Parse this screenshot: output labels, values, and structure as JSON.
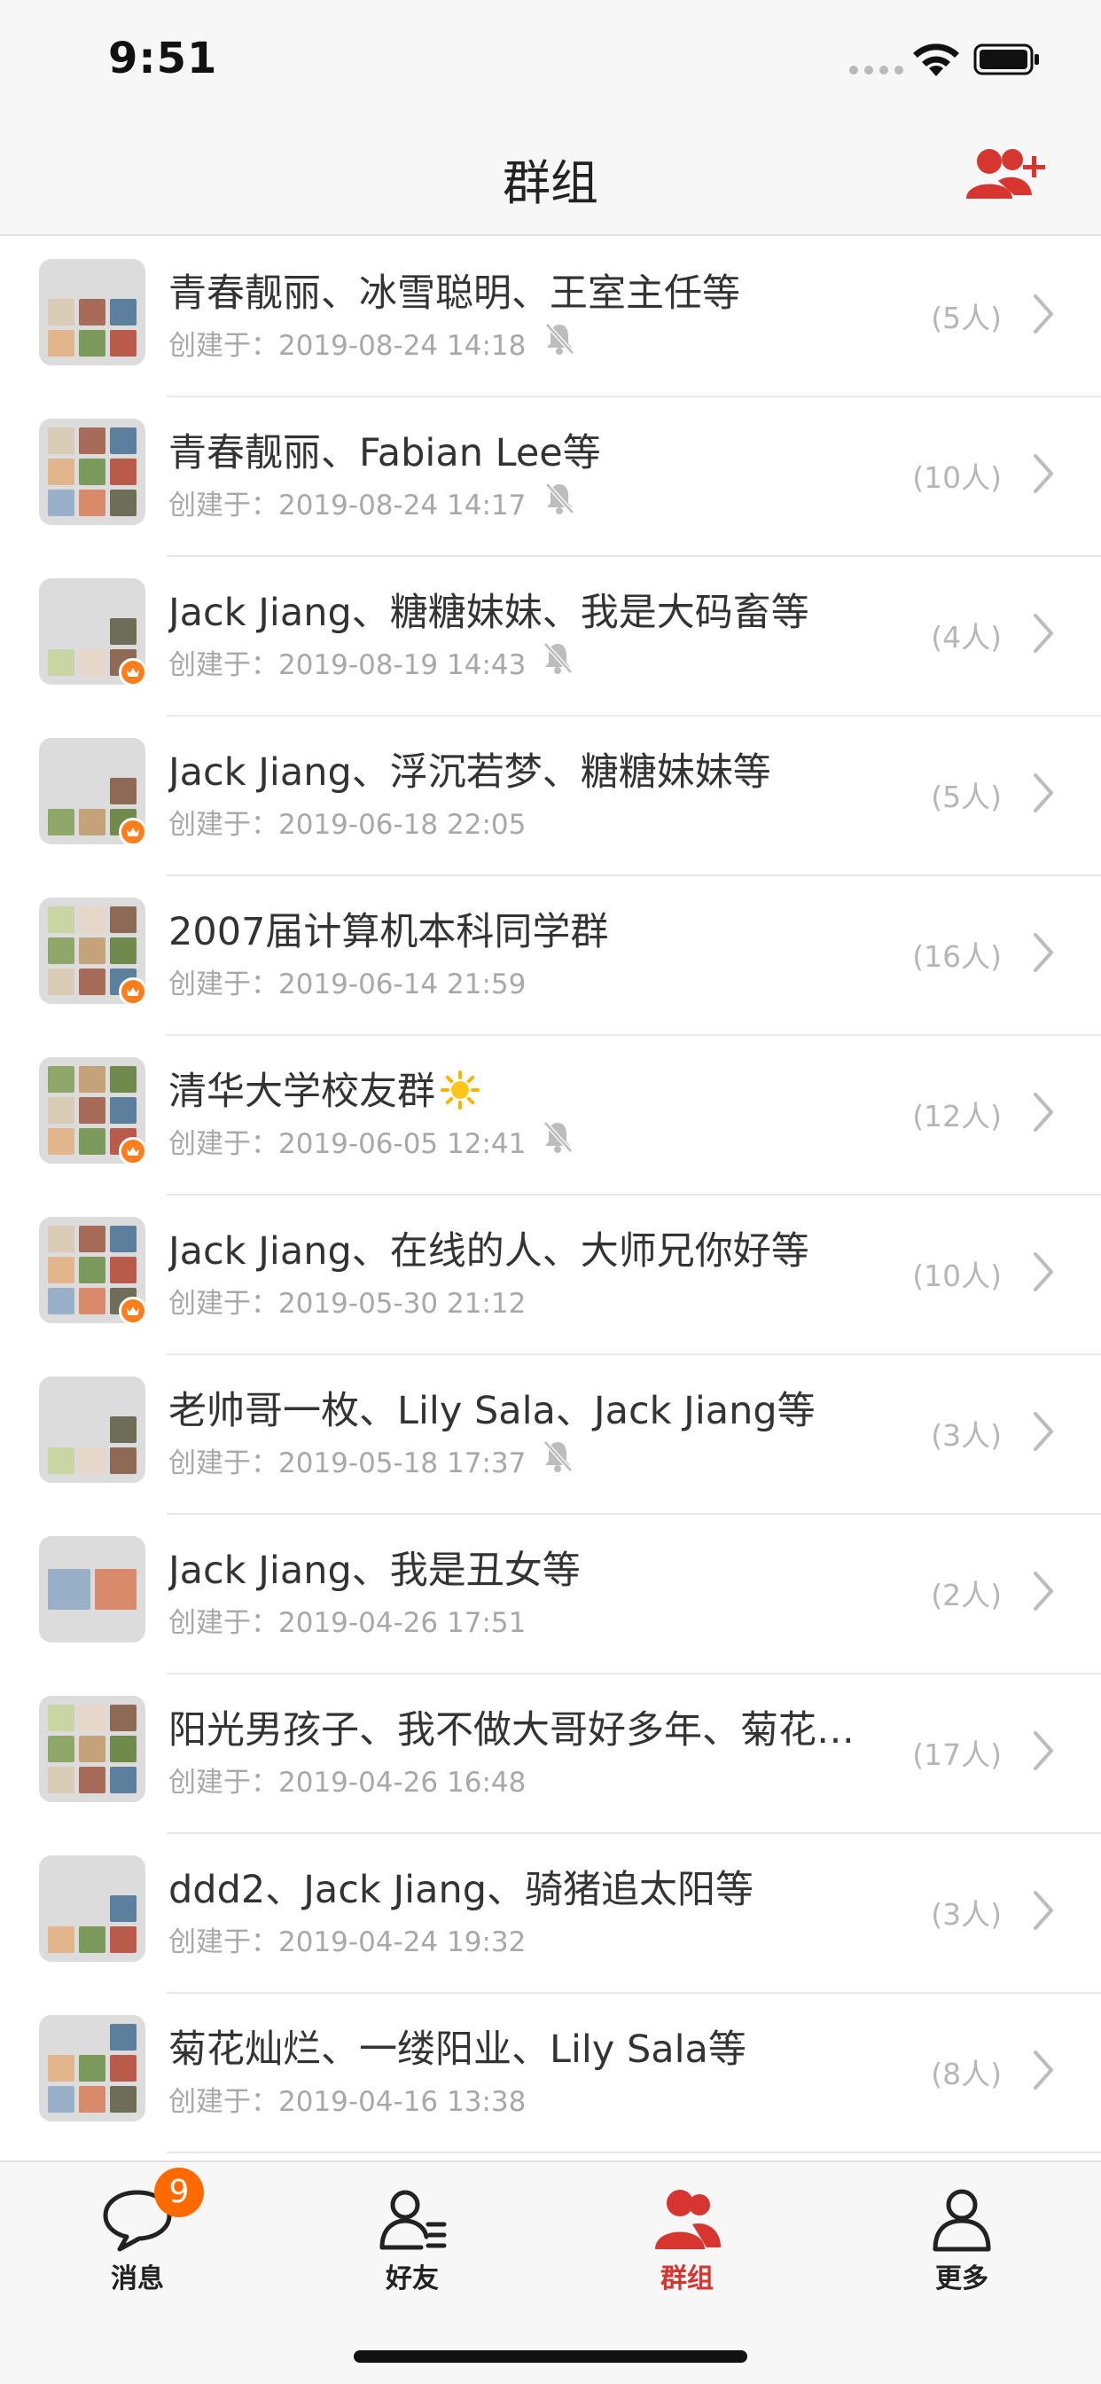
{
  "status_bar": {
    "time": "9:51"
  },
  "nav": {
    "title": "群组"
  },
  "groups": [
    {
      "name": "青春靓丽、冰雪聪明、王室主任等",
      "created": "创建于：2019-08-24 14:18",
      "count": "(5人)",
      "muted": true,
      "owner": false
    },
    {
      "name": "青春靓丽、Fabian Lee等",
      "created": "创建于：2019-08-24 14:17",
      "count": "(10人)",
      "muted": true,
      "owner": false
    },
    {
      "name": "Jack Jiang、糖糖妹妹、我是大码畜等",
      "created": "创建于：2019-08-19 14:43",
      "count": "(4人)",
      "muted": true,
      "owner": true
    },
    {
      "name": "Jack Jiang、浮沉若梦、糖糖妹妹等",
      "created": "创建于：2019-06-18 22:05",
      "count": "(5人)",
      "muted": false,
      "owner": true
    },
    {
      "name": "2007届计算机本科同学群",
      "created": "创建于：2019-06-14 21:59",
      "count": "(16人)",
      "muted": false,
      "owner": true
    },
    {
      "name": "清华大学校友群",
      "created": "创建于：2019-06-05 12:41",
      "count": "(12人)",
      "muted": true,
      "owner": true,
      "emoji": "sun-icon"
    },
    {
      "name": "Jack Jiang、在线的人、大师兄你好等",
      "created": "创建于：2019-05-30 21:12",
      "count": "(10人)",
      "muted": false,
      "owner": true
    },
    {
      "name": "老帅哥一枚、Lily Sala、Jack Jiang等",
      "created": "创建于：2019-05-18 17:37",
      "count": "(3人)",
      "muted": true,
      "owner": false
    },
    {
      "name": "Jack Jiang、我是丑女等",
      "created": "创建于：2019-04-26 17:51",
      "count": "(2人)",
      "muted": false,
      "owner": false
    },
    {
      "name": "阳光男孩子、我不做大哥好多年、菊花…",
      "created": "创建于：2019-04-26 16:48",
      "count": "(17人)",
      "muted": false,
      "owner": false
    },
    {
      "name": "ddd2、Jack Jiang、骑猪追太阳等",
      "created": "创建于：2019-04-24 19:32",
      "count": "(3人)",
      "muted": false,
      "owner": false
    },
    {
      "name": "菊花灿烂、一缕阳业、Lily Sala等",
      "created": "创建于：2019-04-16 13:38",
      "count": "(8人)",
      "muted": false,
      "owner": false
    }
  ],
  "tabs": [
    {
      "label": "消息",
      "icon": "chat-bubble-icon",
      "badge": "9",
      "active": false
    },
    {
      "label": "好友",
      "icon": "contacts-icon",
      "active": false
    },
    {
      "label": "群组",
      "icon": "group-icon",
      "active": true
    },
    {
      "label": "更多",
      "icon": "person-icon",
      "active": false
    }
  ],
  "colors": {
    "accent": "#d6362f",
    "badge": "#ff6a00",
    "crown": "#ff7e1c"
  }
}
